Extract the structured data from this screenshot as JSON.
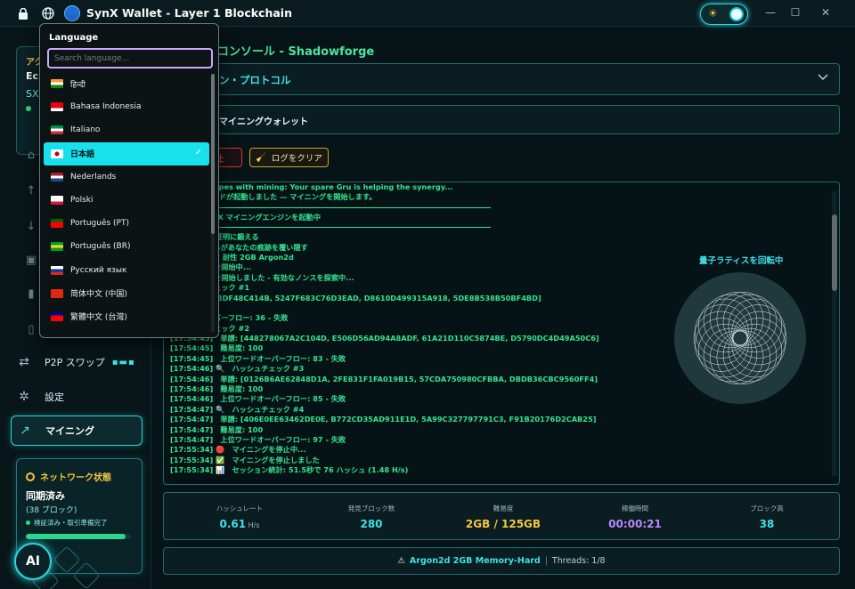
{
  "app": {
    "title": "SynX Wallet - Layer 1 Blockchain"
  },
  "icons": {
    "lock": "lock-icon",
    "globe": "globe-icon",
    "shield": "shield-logo-icon",
    "theme": "sun-icon"
  },
  "window_controls": {
    "minimize": "—",
    "maximize": "☐",
    "close": "✕"
  },
  "sidebar": {
    "account_label": "アク",
    "account_name": "Ec",
    "account_symbol": "SX",
    "nav": [
      {
        "icon": "⌂",
        "label": ""
      },
      {
        "icon": "↑",
        "label": ""
      },
      {
        "icon": "↓",
        "label": ""
      },
      {
        "icon": "▣",
        "label": ""
      },
      {
        "icon": "▮",
        "label": ""
      },
      {
        "icon": "▯",
        "label": ""
      }
    ],
    "p2p_label": "P2P スワップ",
    "settings_label": "設定",
    "mining_label": "マイニング",
    "network": {
      "title": "ネットワーク状態",
      "status": "同期済み",
      "blocks": "(38 ブロック)",
      "verified": "検証済み・取引準備完了",
      "progress": 0.95
    },
    "ai_label": "AI"
  },
  "main": {
    "title": "コンソール - Shadowforge",
    "protocol": "ン・プロトコル",
    "wallet": "マイニングウォレット",
    "stop": "止",
    "clear": "ログをクリア",
    "log": [
      "rted — groupes with mining: Your spare Gru is helping the synergy...",
      "dra] 貢献ヘッドが起動しました — マイニングを開始します。",
      "—SEP—",
      "SerendipityX マイニングエンジンを起動中",
      "—SEP—",
      "● 影を印いて証明に鍛える",
      "べてのサイクルがあなたの痕跡を覆い隠す",
      "PU のみ ASIC 耐性 2GB Argon2d",
      "　ノンス探索を開始中...",
      "　マイニングを開始しました - 有効なノンスを探索中...",
      "　ハッシュチェック #1",
      "譜: [5A11288DF48C414B, 5247F683C76D3EAD, D8610D499315A918, 5DE8B538B50BF4BD]",
      "易度: 100",
      "位ワードオーバーフロー: 36 - 失敗",
      "　ハッシュチェック #2",
      "[17:54:45]　単譜: [448278067A2C104D, E506D56AD94A8ADF, 61A21D110C5874BE, D5790DC4D49A50C6]",
      "[17:54:45]　難易度: 100",
      "[17:54:45]　上位ワードオーバーフロー: 83 - 失敗",
      "[17:54:46] 🔍　ハッシュチェック #3",
      "[17:54:46]　単譜: [0126B6AE62848D1A, 2FE831F1FA019B15, 57CDA750980CFBBA, DBDB36CBC9560FF4]",
      "[17:54:46]　難易度: 100",
      "[17:54:46]　上位ワードオーバーフロー: 85 - 失敗",
      "[17:54:47] 🔍　ハッシュチェック #4",
      "[17:54:47]　単譜: [406E0EE63462DE0E, B772CD35AD911E1D, 5A99C327797791C3, F91B20176D2CAB25]",
      "[17:54:47]　難易度: 100",
      "[17:54:47]　上位ワードオーバーフロー: 97 - 失敗",
      "[17:55:34] 🔴　マイニングを停止中...",
      "[17:55:34] ✅　マイニングを停止しました",
      "[17:55:34] 📊　セッション統計: 51.5秒で 76 ハッシュ (1.48 H/s)"
    ],
    "lattice_title": "量子ラティスを回転中",
    "stats": [
      {
        "key": "ハッシュレート",
        "value": "0.61",
        "unit": "H/s",
        "color": "#3fe0e8"
      },
      {
        "key": "発見ブロック数",
        "value": "280",
        "unit": "",
        "color": "#3fe0e8"
      },
      {
        "key": "難易度",
        "value": "2GB / 125GB",
        "unit": "",
        "color": "#f4c542"
      },
      {
        "key": "稼働時間",
        "value": "00:00:21",
        "unit": "",
        "color": "#b986ff"
      },
      {
        "key": "ブロック高",
        "value": "38",
        "unit": "",
        "color": "#3fe0e8"
      }
    ],
    "algo": {
      "name": "Argon2d 2GB Memory-Hard",
      "sep": "|",
      "threads": "Threads: 1/8"
    }
  },
  "language": {
    "title": "Language",
    "search_placeholder": "Search language...",
    "items": [
      {
        "label": "हिन्दी",
        "flag": [
          "#ff9933",
          "#ffffff",
          "#138808"
        ]
      },
      {
        "label": "Bahasa Indonesia",
        "flag": [
          "#e70011",
          "#e70011",
          "#ffffff"
        ]
      },
      {
        "label": "Italiano",
        "flag": [
          "#009246",
          "#ffffff",
          "#ce2b37"
        ]
      },
      {
        "label": "日本語",
        "flag": [
          "#ffffff",
          "#bc002d",
          "#ffffff"
        ]
      },
      {
        "label": "Nederlands",
        "flag": [
          "#ae1c28",
          "#ffffff",
          "#21468b"
        ]
      },
      {
        "label": "Polski",
        "flag": [
          "#ffffff",
          "#ffffff",
          "#dc143c"
        ]
      },
      {
        "label": "Português (PT)",
        "flag": [
          "#006600",
          "#ff0000",
          "#ff0000"
        ]
      },
      {
        "label": "Português (BR)",
        "flag": [
          "#009c3b",
          "#ffdf00",
          "#009c3b"
        ]
      },
      {
        "label": "Русский язык",
        "flag": [
          "#ffffff",
          "#0039a6",
          "#d52b1e"
        ]
      },
      {
        "label": "简体中文 (中国)",
        "flag": [
          "#de2910",
          "#de2910",
          "#de2910"
        ]
      },
      {
        "label": "繁體中文 (台灣)",
        "flag": [
          "#000095",
          "#fe0000",
          "#fe0000"
        ]
      }
    ],
    "selected_index": 3,
    "check": "✓"
  }
}
